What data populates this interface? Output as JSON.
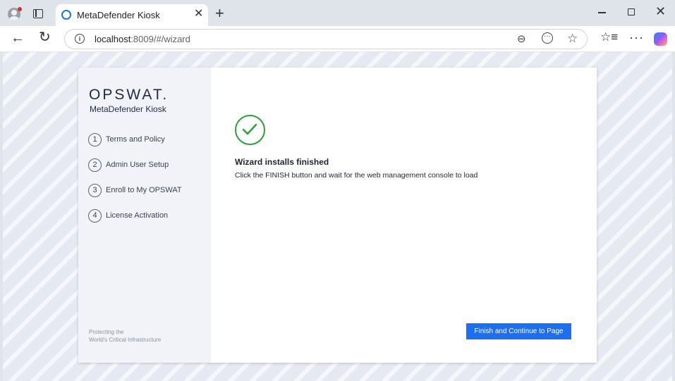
{
  "browser": {
    "tab_title": "MetaDefender Kiosk",
    "url_host": "localhost",
    "url_rest": ":8009/#/wizard"
  },
  "sidebar": {
    "logo": "OPSWAT.",
    "product": "MetaDefender Kiosk",
    "steps": [
      {
        "num": "1",
        "label": "Terms and Policy"
      },
      {
        "num": "2",
        "label": "Admin User Setup"
      },
      {
        "num": "3",
        "label": "Enroll to My OPSWAT"
      },
      {
        "num": "4",
        "label": "License Activation"
      }
    ],
    "tagline_line1": "Protecting the",
    "tagline_line2": "World's Critical Infrastructure"
  },
  "main": {
    "title": "Wizard installs finished",
    "message": "Click the FINISH button and wait for the web management console to load",
    "finish_label": "Finish and Continue to Page"
  },
  "colors": {
    "accent": "#1d6ff0",
    "success": "#2e9e3b"
  },
  "icons": {
    "profile": "profile-avatar-icon",
    "tabs": "tab-actions-icon",
    "favicon": "loading-circle-icon",
    "success": "checkmark-circle-icon"
  }
}
